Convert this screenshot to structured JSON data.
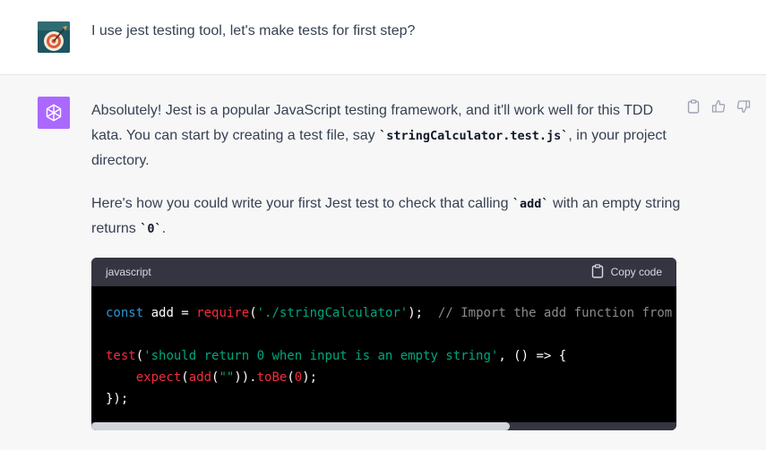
{
  "user": {
    "message": "I use jest testing tool, let's make tests for first step?"
  },
  "assistant": {
    "para1_a": "Absolutely! Jest is a popular JavaScript testing framework, and it'll work well for this TDD kata. You can start by creating a test file, say ",
    "para1_code": "`stringCalculator.test.js`",
    "para1_b": ", in your project directory.",
    "para2_a": "Here's how you could write your first Jest test to check that calling ",
    "para2_code1": "`add`",
    "para2_b": " with an empty string returns ",
    "para2_code2": "`0`",
    "para2_c": "."
  },
  "code_block": {
    "language": "javascript",
    "copy_label": "Copy code",
    "lines": {
      "l1_kw": "const",
      "l1_var": " add = ",
      "l1_fn": "require",
      "l1_p1": "(",
      "l1_str": "'./stringCalculator'",
      "l1_p2": ");  ",
      "l1_comment": "// Import the add function from your module",
      "l3_fn": "test",
      "l3_p1": "(",
      "l3_str": "'should return 0 when input is an empty string'",
      "l3_p2": ", () => {",
      "l4_indent": "    ",
      "l4_fn1": "expect",
      "l4_p1": "(",
      "l4_fn2": "add",
      "l4_p2": "(",
      "l4_str": "\"\"",
      "l4_p3": ")).",
      "l4_fn3": "toBe",
      "l4_p4": "(",
      "l4_num": "0",
      "l4_p5": ");",
      "l5": "});"
    },
    "scroll_fraction": 0.715
  },
  "icons": [
    "copy-icon",
    "thumbs-up-icon",
    "thumbs-down-icon",
    "clipboard-icon",
    "openai-logo-icon"
  ],
  "colors": {
    "avatar_bg": "#ab68ff",
    "code_bg": "#000000",
    "code_header_bg": "#343541"
  }
}
